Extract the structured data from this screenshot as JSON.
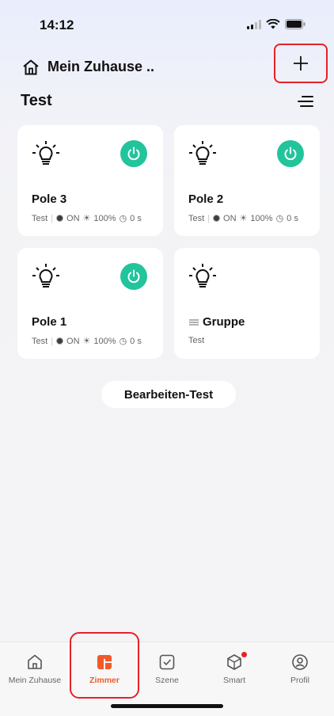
{
  "status": {
    "time": "14:12"
  },
  "header": {
    "home_label": "Mein Zuhause .."
  },
  "room": {
    "title": "Test"
  },
  "devices": [
    {
      "name": "Pole 3",
      "room": "Test",
      "state": "ON",
      "brightness": "100%",
      "timer": "0 s"
    },
    {
      "name": "Pole 2",
      "room": "Test",
      "state": "ON",
      "brightness": "100%",
      "timer": "0 s"
    },
    {
      "name": "Pole 1",
      "room": "Test",
      "state": "ON",
      "brightness": "100%",
      "timer": "0 s"
    }
  ],
  "group": {
    "name": "Gruppe",
    "room": "Test"
  },
  "edit_button": "Bearbeiten-Test",
  "tabs": [
    {
      "label": "Mein Zuhause"
    },
    {
      "label": "Zimmer"
    },
    {
      "label": "Szene"
    },
    {
      "label": "Smart"
    },
    {
      "label": "Profil"
    }
  ],
  "colors": {
    "accent": "#f05a28",
    "power_on": "#22c49b",
    "highlight": "#e8202a"
  }
}
